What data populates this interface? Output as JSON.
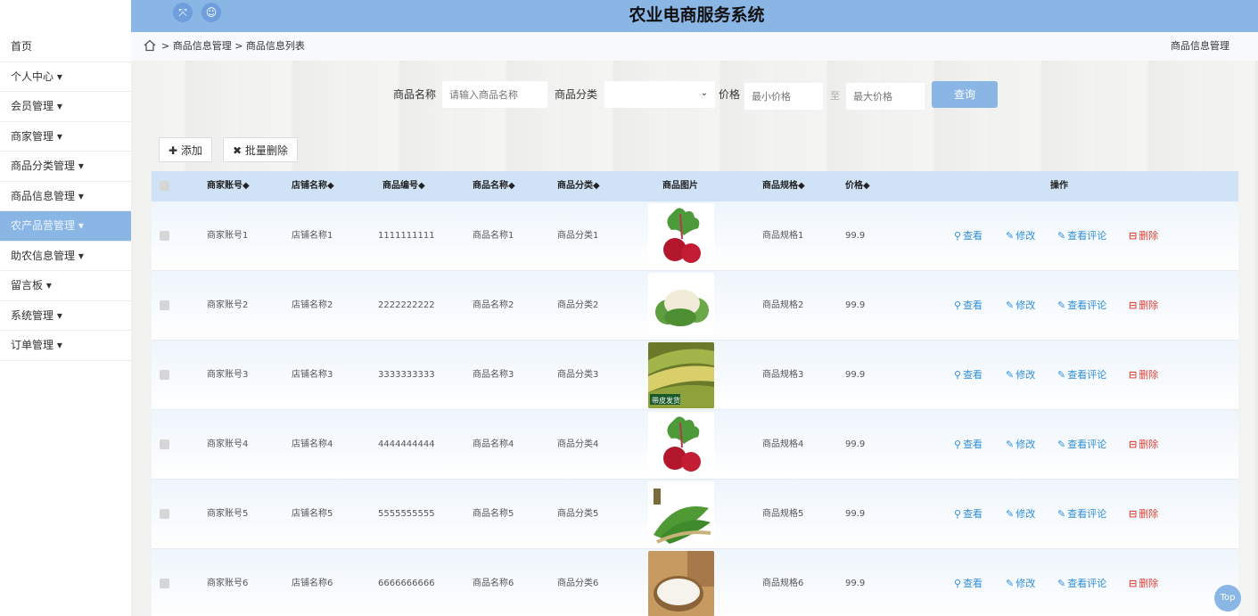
{
  "header": {
    "title": "农业电商服务系统",
    "icons": [
      "fullscreen-icon",
      "user-icon"
    ]
  },
  "sidebar": {
    "items": [
      {
        "label": "首页"
      },
      {
        "label": "个人中心 ▾"
      },
      {
        "label": "会员管理 ▾"
      },
      {
        "label": "商家管理 ▾"
      },
      {
        "label": "商品分类管理 ▾"
      },
      {
        "label": "商品信息管理 ▾"
      },
      {
        "label": "农产品营管理 ▾",
        "active": true
      },
      {
        "label": "助农信息管理 ▾"
      },
      {
        "label": "留言板 ▾"
      },
      {
        "label": "系统管理 ▾"
      },
      {
        "label": "订单管理 ▾"
      }
    ]
  },
  "breadcrumb": {
    "path": "> 商品信息管理 > 商品信息列表",
    "right": "商品信息管理"
  },
  "search": {
    "name_label": "商品名称",
    "name_placeholder": "请输入商品名称",
    "category_label": "商品分类",
    "category_value": "",
    "price_label": "价格",
    "min_placeholder": "最小价格",
    "to_label": "至",
    "max_placeholder": "最大价格",
    "query_label": "查询"
  },
  "toolbar": {
    "add_label": "✚ 添加",
    "batch_delete_label": "✖ 批量删除"
  },
  "table": {
    "headers": [
      "商家账号◆",
      "店铺名称◆",
      "商品编号◆",
      "商品名称◆",
      "商品分类◆",
      "商品图片",
      "商品规格◆",
      "价格◆",
      "操作"
    ],
    "actions": {
      "view": "查看",
      "edit": "修改",
      "review": "查看评论",
      "delete": "删除"
    },
    "rows": [
      {
        "account": "商家账号1",
        "shop": "店铺名称1",
        "code": "1111111111",
        "name": "商品名称1",
        "category": "商品分类1",
        "image": "beet",
        "spec": "商品规格1",
        "price": "99.9"
      },
      {
        "account": "商家账号2",
        "shop": "店铺名称2",
        "code": "2222222222",
        "name": "商品名称2",
        "category": "商品分类2",
        "image": "cauliflower",
        "spec": "商品规格2",
        "price": "99.9"
      },
      {
        "account": "商家账号3",
        "shop": "店铺名称3",
        "code": "3333333333",
        "name": "商品名称3",
        "category": "商品分类3",
        "image": "corn",
        "spec": "商品规格3",
        "price": "99.9",
        "image_text": "带皮发货"
      },
      {
        "account": "商家账号4",
        "shop": "店铺名称4",
        "code": "4444444444",
        "name": "商品名称4",
        "category": "商品分类4",
        "image": "beet",
        "spec": "商品规格4",
        "price": "99.9"
      },
      {
        "account": "商家账号5",
        "shop": "店铺名称5",
        "code": "5555555555",
        "name": "商品名称5",
        "category": "商品分类5",
        "image": "greens",
        "spec": "商品规格5",
        "price": "99.9"
      },
      {
        "account": "商家账号6",
        "shop": "店铺名称6",
        "code": "6666666666",
        "name": "商品名称6",
        "category": "商品分类6",
        "image": "rice",
        "spec": "商品规格6",
        "price": "99.9"
      }
    ]
  },
  "top_button": "Top",
  "colors": {
    "accent": "#8ab6e6",
    "link": "#2f8fd9",
    "danger": "#e2453a"
  }
}
